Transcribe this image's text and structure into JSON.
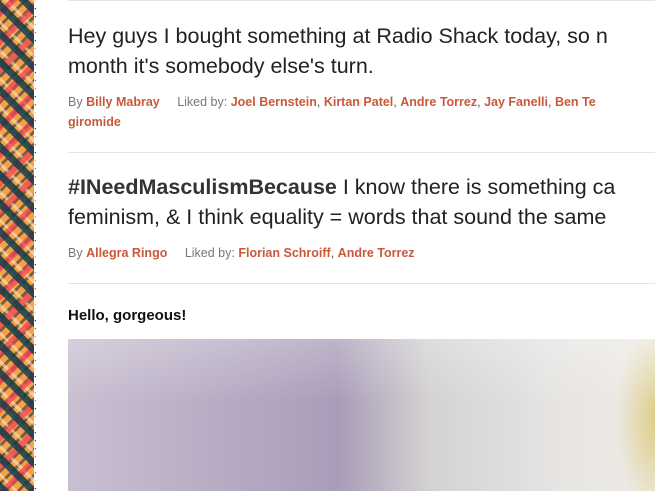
{
  "posts": [
    {
      "text_line1": "Hey guys I bought something at Radio Shack today, so n",
      "text_line2": "month it's somebody else's turn.",
      "by_label": "By",
      "author": "Billy Mabray",
      "liked_label": "Liked by:",
      "likers": [
        "Joel Bernstein",
        "Kirtan Patel",
        "Andre Torrez",
        "Jay Fanelli",
        "Ben Te"
      ],
      "likers_line2": "giromide"
    },
    {
      "hashtag": "#INeedMasculismBecause",
      "text_line1_rest": " I know there is something ca",
      "text_line2": "feminism, & I think equality = words that sound the same",
      "by_label": "By",
      "author": "Allegra Ringo",
      "liked_label": "Liked by:",
      "likers": [
        "Florian Schroiff",
        "Andre Torrez"
      ]
    }
  ],
  "photo_post": {
    "title": "Hello, gorgeous!"
  }
}
